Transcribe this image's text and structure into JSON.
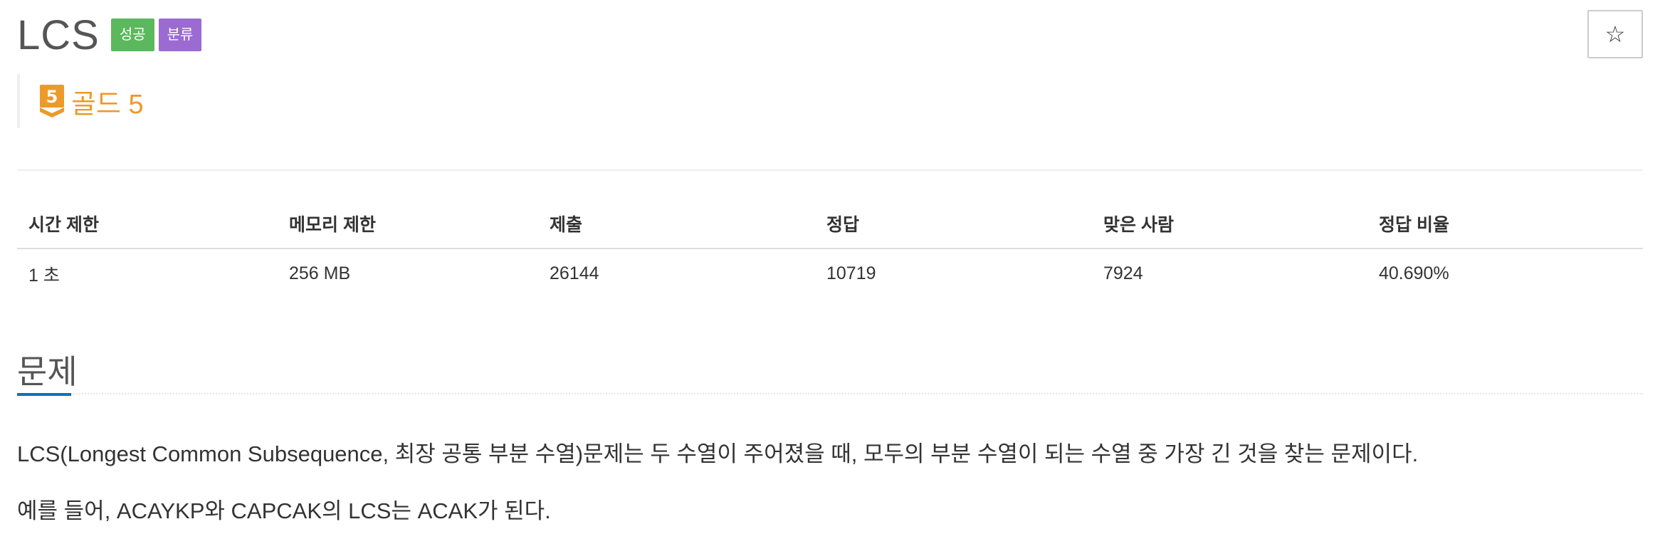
{
  "header": {
    "title": "LCS",
    "badges": {
      "success": "성공",
      "category": "분류"
    },
    "star_icon": "☆"
  },
  "tier": {
    "icon_number": "5",
    "label": "골드 5",
    "color": "#ec9a29"
  },
  "info": {
    "headers": [
      "시간 제한",
      "메모리 제한",
      "제출",
      "정답",
      "맞은 사람",
      "정답 비율"
    ],
    "values": [
      "1 초",
      "256 MB",
      "26144",
      "10719",
      "7924",
      "40.690%"
    ]
  },
  "problem": {
    "section_title": "문제",
    "paragraphs": [
      "LCS(Longest Common Subsequence, 최장 공통 부분 수열)문제는 두 수열이 주어졌을 때, 모두의 부분 수열이 되는 수열 중 가장 긴 것을 찾는 문제이다.",
      "예를 들어, ACAYKP와 CAPCAK의 LCS는 ACAK가 된다."
    ]
  },
  "colors": {
    "success": "#5cb85c",
    "category": "#9b6bd1",
    "accent": "#0076c0"
  }
}
